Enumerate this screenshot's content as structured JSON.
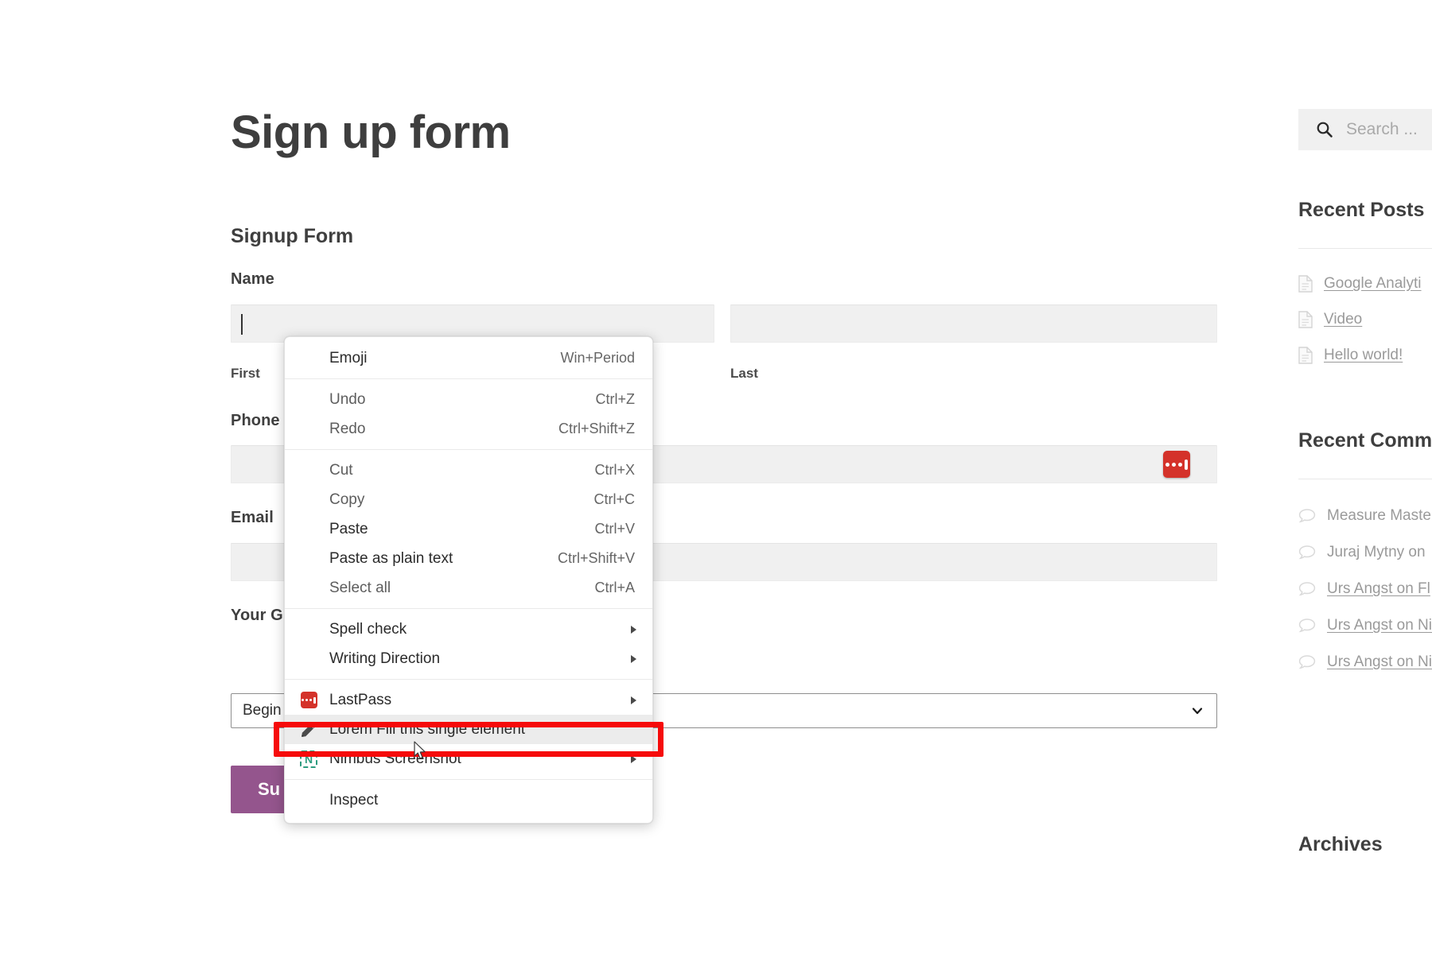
{
  "page": {
    "title": "Sign up form",
    "form_heading": "Signup Form"
  },
  "form": {
    "name_label": "Name",
    "first_sublabel": "First",
    "last_sublabel": "Last",
    "phone_label": "Phone",
    "email_label": "Email",
    "gender_label": "Your G",
    "select_value": "Begin",
    "submit_label": "Su",
    "name_first_value": "",
    "name_last_value": "",
    "phone_value": "",
    "email_value": ""
  },
  "sidebar": {
    "search": {
      "icon": "search-icon",
      "placeholder": "Search ..."
    },
    "recent_posts": {
      "heading": "Recent Posts",
      "items": [
        {
          "icon": "document-icon",
          "label": "Google Analyti"
        },
        {
          "icon": "document-icon",
          "label": "Video"
        },
        {
          "icon": "document-icon",
          "label": "Hello world!"
        }
      ]
    },
    "recent_comments": {
      "heading": "Recent Comm",
      "items": [
        {
          "icon": "comment-bubble-icon",
          "label": "Measure Master"
        },
        {
          "icon": "comment-bubble-icon",
          "label": "Juraj Mytny on "
        },
        {
          "icon": "comment-bubble-icon",
          "label": "Urs Angst on Fl"
        },
        {
          "icon": "comment-bubble-icon",
          "label": "Urs Angst on Ni"
        },
        {
          "icon": "comment-bubble-icon",
          "label": "Urs Angst on Ni"
        }
      ]
    },
    "archives": {
      "heading": "Archives"
    }
  },
  "context_menu": {
    "groups": [
      {
        "items": [
          {
            "label": "Emoji",
            "accel": "Win+Period",
            "enabled": true,
            "submenu": false,
            "icon": null
          }
        ]
      },
      {
        "items": [
          {
            "label": "Undo",
            "accel": "Ctrl+Z",
            "enabled": false,
            "submenu": false,
            "icon": null
          },
          {
            "label": "Redo",
            "accel": "Ctrl+Shift+Z",
            "enabled": false,
            "submenu": false,
            "icon": null
          }
        ]
      },
      {
        "items": [
          {
            "label": "Cut",
            "accel": "Ctrl+X",
            "enabled": false,
            "submenu": false,
            "icon": null
          },
          {
            "label": "Copy",
            "accel": "Ctrl+C",
            "enabled": false,
            "submenu": false,
            "icon": null
          },
          {
            "label": "Paste",
            "accel": "Ctrl+V",
            "enabled": true,
            "submenu": false,
            "icon": null
          },
          {
            "label": "Paste as plain text",
            "accel": "Ctrl+Shift+V",
            "enabled": true,
            "submenu": false,
            "icon": null
          },
          {
            "label": "Select all",
            "accel": "Ctrl+A",
            "enabled": false,
            "submenu": false,
            "icon": null
          }
        ]
      },
      {
        "items": [
          {
            "label": "Spell check",
            "accel": "",
            "enabled": true,
            "submenu": true,
            "icon": null
          },
          {
            "label": "Writing Direction",
            "accel": "",
            "enabled": true,
            "submenu": true,
            "icon": null
          }
        ]
      },
      {
        "items": [
          {
            "label": "LastPass",
            "accel": "",
            "enabled": true,
            "submenu": true,
            "icon": "lastpass-icon"
          },
          {
            "label": "Lorem Fill this single element",
            "accel": "",
            "enabled": true,
            "submenu": false,
            "icon": "pencil-icon",
            "highlighted": true
          },
          {
            "label": "Nimbus Screenshot",
            "accel": "",
            "enabled": true,
            "submenu": true,
            "icon": "nimbus-icon"
          }
        ]
      },
      {
        "items": [
          {
            "label": "Inspect",
            "accel": "",
            "enabled": true,
            "submenu": false,
            "icon": null
          }
        ]
      }
    ]
  },
  "annotation": {
    "highlight_color": "#f60b0b",
    "target_label": "Lorem Fill this single element"
  },
  "colors": {
    "accent_purple": "#94558d",
    "lastpass_red": "#d4322a",
    "nimbus_green": "#2d9c7f",
    "input_bg": "#f0f0f0",
    "heading_text": "#3f3f3f"
  }
}
